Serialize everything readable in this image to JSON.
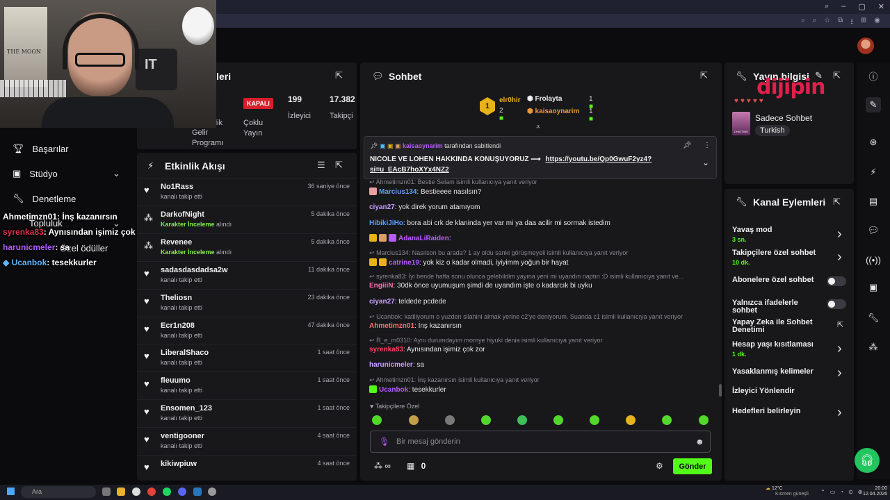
{
  "sidebar": {
    "items": [
      {
        "label": "Başarılar"
      },
      {
        "label": "Stüdyo"
      },
      {
        "label": "Denetleme"
      },
      {
        "label": "Topluluk"
      },
      {
        "label": "Özel ödüller"
      }
    ],
    "ghost_text": "ci... Topluluk... pcdede"
  },
  "overlay_chat": [
    {
      "user": "Ahmetimzn01",
      "text": ": İnş kazanırsın",
      "color": "#ffffff"
    },
    {
      "user": "syrenka83",
      "text": ": Aynısından işimiz çok zor",
      "color": "#e0304a"
    },
    {
      "user": "harunicmeler",
      "text": ": sa",
      "color": "#b05cff"
    },
    {
      "user": "Ucanbok",
      "text": ": tesekkurler",
      "color": "#5fb4ff"
    }
  ],
  "stats": {
    "title": "stikleri",
    "cells": [
      {
        "value": "",
        "label": "rlik"
      },
      {
        "value": "",
        "label": "Gelir Programı"
      },
      {
        "value": "",
        "label": "Çoklu Yayın"
      },
      {
        "value": "199",
        "label": "İzleyici"
      },
      {
        "value": "17.382",
        "label": "Takipçi"
      }
    ],
    "badge": "KAPALI"
  },
  "feed": {
    "title": "Etkinlik Akışı",
    "items": [
      {
        "name": "No1Rass",
        "action": "kanalı takip etti",
        "extra": "",
        "suffix": "",
        "time": "36 saniye önce"
      },
      {
        "name": "DarkofNight",
        "action": "",
        "extra": "Karakter İnceleme",
        "suffix": " alındı",
        "time": "5 dakika önce"
      },
      {
        "name": "Revenee",
        "action": "",
        "extra": "Karakter İnceleme",
        "suffix": " alındı",
        "time": "5 dakika önce"
      },
      {
        "name": "sadasdasdadsa2w",
        "action": "kanalı takip etti",
        "extra": "",
        "suffix": "",
        "time": "11 dakika önce"
      },
      {
        "name": "Theliosn",
        "action": "kanalı takip etti",
        "extra": "",
        "suffix": "",
        "time": "23 dakika önce"
      },
      {
        "name": "Ecr1n208",
        "action": "kanalı takip etti",
        "extra": "",
        "suffix": "",
        "time": "47 dakika önce"
      },
      {
        "name": "LiberalShaco",
        "action": "kanalı takip etti",
        "extra": "",
        "suffix": "",
        "time": "1 saat önce"
      },
      {
        "name": "fleuumo",
        "action": "kanalı takip etti",
        "extra": "",
        "suffix": "",
        "time": "1 saat önce"
      },
      {
        "name": "Ensomen_123",
        "action": "kanalı takip etti",
        "extra": "",
        "suffix": "",
        "time": "1 saat önce"
      },
      {
        "name": "ventigooner",
        "action": "kanalı takip etti",
        "extra": "",
        "suffix": "",
        "time": "4 saat önce"
      },
      {
        "name": "kikiwpiuw",
        "action": "",
        "extra": "",
        "suffix": "",
        "time": "4 saat önce"
      }
    ]
  },
  "chat": {
    "title": "Sohbet",
    "leaderboard": [
      {
        "name": "elr0hir",
        "count": "2",
        "rank": "1"
      },
      {
        "name": "Frolayta",
        "count": "1"
      },
      {
        "name": "kaisaoynarim",
        "count": "1"
      }
    ],
    "pinned": {
      "by_user": "kaisaoynarim",
      "by_text": "tarafından sabitlendi",
      "message": "NICOLE VE LOHEN HAKKINDA KONUŞUYORUZ ⟶",
      "link_line1": "https://youtu.be/Qp0GwuF2yz4?",
      "link_line2": "si=u_EAcB7hoXYx4NZ2"
    },
    "messages": [
      {
        "type": "reply",
        "text": "Ahmetimzn01: Bestie Selam isimli kullanıcıya yanıt veriyor"
      },
      {
        "type": "msg",
        "user": "Marcius134",
        "ucolor": "#5f9dff",
        "text": ": Bestieeee nasılsın?"
      },
      {
        "type": "msg",
        "user": "ciyan27",
        "ucolor": "#c8a0ff",
        "text": ": yok direk yorum atamıyom"
      },
      {
        "type": "msg",
        "user": "HibikiJiHo",
        "ucolor": "#5f9dff",
        "text": ": bora abi crk de klaninda yer var mi ya daa acilir mi sormak istedim"
      },
      {
        "type": "msg",
        "user": "AdanaLiRaiden",
        "ucolor": "#b45cff",
        "text": ":"
      },
      {
        "type": "reply",
        "text": "Marcius134: Nasılson bu arada? 1 ay oldu sanki görüşmeyeli isimli kullanıcıya yanıt veriyor"
      },
      {
        "type": "msg",
        "user": "catrine19",
        "ucolor": "#b45cff",
        "text": ": yok kiz o kadar olmadi, iyiyimm yoğun bir hayat"
      },
      {
        "type": "reply",
        "text": "syrenka83: İyi bende hafta sonu olunca gelebildim yayına yeni mi uyandın naptın :D isimli kullanıcıya yanıt ve..."
      },
      {
        "type": "msg",
        "user": "EngiiiN",
        "ucolor": "#ff6fae",
        "text": ": 30dk önce uyumuşum şimdi de uyandım işte o kadarcık bi uyku"
      },
      {
        "type": "msg",
        "user": "ciyan27",
        "ucolor": "#c8a0ff",
        "text": ": teldede pcdede"
      },
      {
        "type": "reply",
        "text": "Ucanbok: katiliyorum o yuzden silahini almak yerine c2'ye deniyorum. Suanda c1 isimli kullanıcıya yanıt veriyor"
      },
      {
        "type": "msg",
        "user": "Ahmetimzn01",
        "ucolor": "#ff7070",
        "text": ": İnş kazanırsın"
      },
      {
        "type": "reply",
        "text": "R_e_m0310: Aynı durumdayım mornye hiyuki denia      isimli kullanıcıya yanıt veriyor"
      },
      {
        "type": "msg",
        "user": "syrenka83",
        "ucolor": "#ff3b5c",
        "text": ": Aynısından işimiz çok zor"
      },
      {
        "type": "msg",
        "user": "harunicmeler",
        "ucolor": "#c8a0ff",
        "text": ": sa"
      },
      {
        "type": "reply",
        "text": "Ahmetimzn01: İnş kazanırsın isimli kullanıcıya yanıt veriyor"
      },
      {
        "type": "msg",
        "user": "Ucanbok",
        "ucolor": "#b45cff",
        "text": ": tesekkurler"
      }
    ],
    "followers_only": "Takipçilere Özel",
    "input_placeholder": "Bir mesaj gönderin",
    "points": "∞",
    "gift_count": "0",
    "send_label": "Gönder"
  },
  "info": {
    "title": "Yayın bilgisi",
    "category": "Sadece Sohbet",
    "language": "Turkish",
    "thumb_label": "CHATTING",
    "watermark": "dijipin"
  },
  "actions": {
    "title": "Kanal Eylemleri",
    "items": [
      {
        "label": "Yavaş mod",
        "sub": "3 sn.",
        "control": "chevron"
      },
      {
        "label": "Takipçilere özel sohbet",
        "sub": "10 dk.",
        "control": "chevron"
      },
      {
        "label": "Abonelere özel sohbet",
        "sub": "",
        "control": "toggle"
      },
      {
        "label": "Yalnızca ifadelerle sohbet",
        "sub": "",
        "control": "toggle"
      },
      {
        "label": "Yapay Zeka ile Sohbet Denetimi",
        "sub": "",
        "control": "external"
      },
      {
        "label": "Hesap yaşı kısıtlaması",
        "sub": "1 dk.",
        "control": "chevron"
      },
      {
        "label": "Yasaklanmış kelimeler",
        "sub": "",
        "control": "chevron"
      },
      {
        "label": "İzleyici Yönlendir",
        "sub": "",
        "control": "none"
      },
      {
        "label": "Hedefleri belirleyin",
        "sub": "",
        "control": "chevron"
      }
    ]
  },
  "taskbar": {
    "search": "Ara",
    "weather": "12°C",
    "weather_desc": "Kısmen güneşli",
    "time": "20:00",
    "date": "12.04.2026"
  },
  "colors": {
    "accent": "#53fc18",
    "panel": "#18181b",
    "background": "#0b0b0d",
    "live_off": "#d71f2b"
  }
}
